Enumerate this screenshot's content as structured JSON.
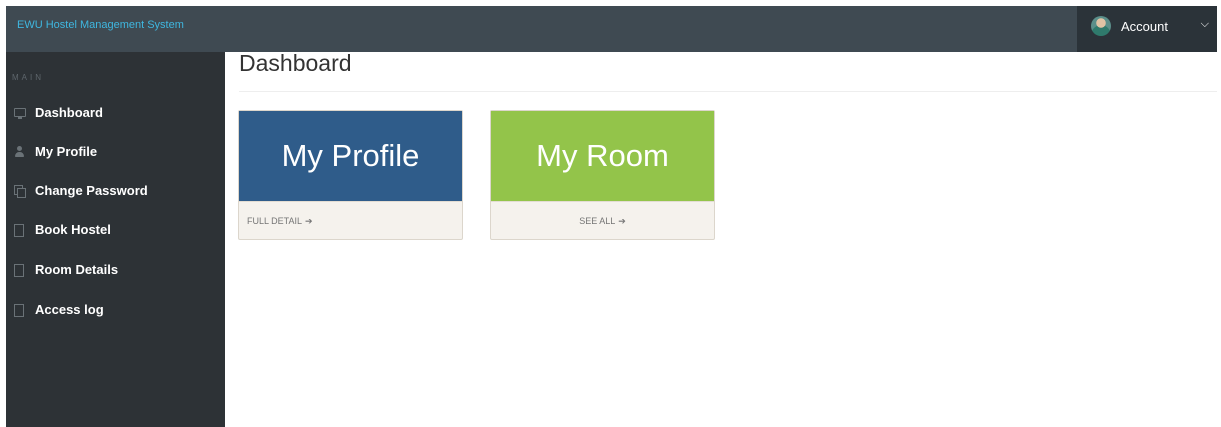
{
  "app": {
    "title": "EWU Hostel Management System"
  },
  "account": {
    "label": "Account",
    "avatar_icon": "user-avatar",
    "caret_icon": "chevron-down-icon"
  },
  "sidebar": {
    "section_label": "MAIN",
    "items": [
      {
        "label": "Dashboard",
        "icon": "monitor-icon"
      },
      {
        "label": "My Profile",
        "icon": "user-icon"
      },
      {
        "label": "Change Password",
        "icon": "copy-icon"
      },
      {
        "label": "Book Hostel",
        "icon": "file-icon"
      },
      {
        "label": "Room Details",
        "icon": "file-icon"
      },
      {
        "label": "Access log",
        "icon": "file-icon"
      }
    ]
  },
  "main": {
    "title": "Dashboard",
    "cards": [
      {
        "title": "My Profile",
        "link": "FULL DETAIL",
        "color": "#2f5c8a"
      },
      {
        "title": "My Room",
        "link": "SEE ALL",
        "color": "#93c44a"
      }
    ]
  },
  "colors": {
    "topbar": "#3f4a52",
    "sidebar": "#2d3236",
    "brand": "#3fb7e0"
  }
}
